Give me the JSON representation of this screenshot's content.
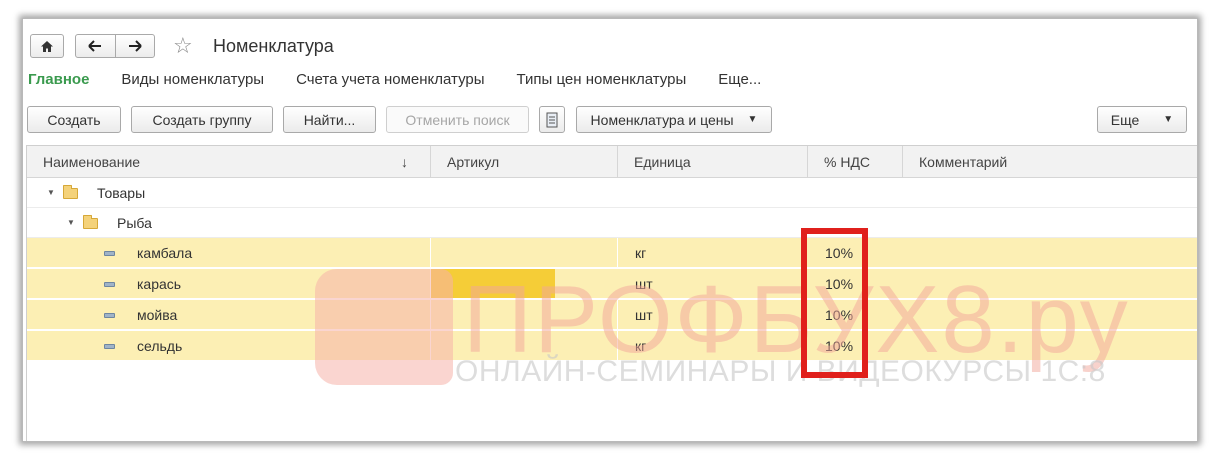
{
  "window": {
    "title": "Номенклатура",
    "home_icon": "home-icon",
    "back_icon": "arrow-left-icon",
    "forward_icon": "arrow-right-icon",
    "favorite_icon": "star-icon"
  },
  "menu": {
    "items": [
      "Главное",
      "Виды номенклатуры",
      "Счета учета номенклатуры",
      "Типы цен номенклатуры",
      "Еще..."
    ],
    "active_color": "#3a9a4e"
  },
  "toolbar": {
    "create": "Создать",
    "create_group": "Создать группу",
    "find": "Найти...",
    "cancel_search": "Отменить поиск",
    "view_select": "Номенклатура и цены",
    "more": "Еще"
  },
  "table": {
    "columns": [
      "Наименование",
      "Артикул",
      "Единица",
      "% НДС",
      "Комментарий"
    ],
    "sort_indicator": "↓",
    "rows": [
      {
        "name": "Товары",
        "type": "group",
        "article": "",
        "unit": "",
        "vat": "",
        "comment": ""
      },
      {
        "name": "Рыба",
        "type": "group",
        "article": "",
        "unit": "",
        "vat": "",
        "comment": ""
      },
      {
        "name": "камбала",
        "type": "item",
        "article": "",
        "unit": "кг",
        "vat": "10%",
        "comment": ""
      },
      {
        "name": "карась",
        "type": "item",
        "article": "",
        "unit": "шт",
        "vat": "10%",
        "comment": ""
      },
      {
        "name": "мойва",
        "type": "item",
        "article": "",
        "unit": "шт",
        "vat": "10%",
        "comment": ""
      },
      {
        "name": "сельдь",
        "type": "item",
        "article": "",
        "unit": "кг",
        "vat": "10%",
        "comment": ""
      }
    ],
    "selected_color": "#fcefb4",
    "highlight_color": "#e0201c"
  },
  "watermark": {
    "main": "ПРОФБУХ8.ру",
    "sub": "ОНЛАЙН-СЕМИНАРЫ И ВИДЕОКУРСЫ 1С:8"
  }
}
